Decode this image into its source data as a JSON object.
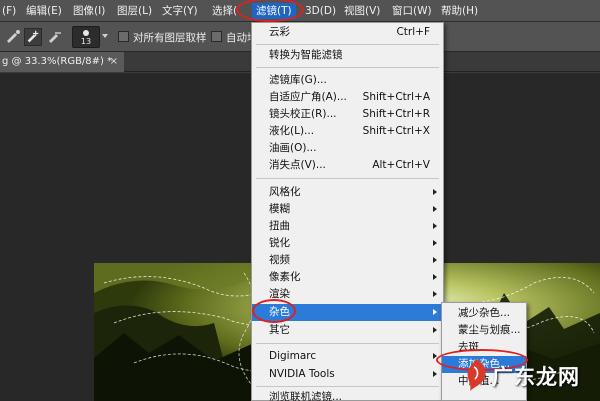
{
  "menubar": {
    "items": [
      "(F)",
      "编辑(E)",
      "图像(I)",
      "图层(L)",
      "文字(Y)",
      "选择(",
      "滤镜(T)",
      "3D(D)",
      "视图(V)",
      "窗口(W)",
      "帮助(H)"
    ],
    "active_index": 6
  },
  "options_bar": {
    "brush_size": "13",
    "sample_all_layers_label": "对所有图层取样",
    "auto_enhance_label": "自动增"
  },
  "document_tab": {
    "title": "g @ 33.3%(RGB/8#) *",
    "close_glyph": "×"
  },
  "filter_menu": {
    "items": [
      {
        "label": "云彩",
        "shortcut": "Ctrl+F"
      },
      {
        "label": "转换为智能滤镜"
      },
      {
        "label": "滤镜库(G)..."
      },
      {
        "label": "自适应广角(A)...",
        "shortcut": "Shift+Ctrl+A"
      },
      {
        "label": "镜头校正(R)...",
        "shortcut": "Shift+Ctrl+R"
      },
      {
        "label": "液化(L)...",
        "shortcut": "Shift+Ctrl+X"
      },
      {
        "label": "油画(O)..."
      },
      {
        "label": "消失点(V)...",
        "shortcut": "Alt+Ctrl+V"
      },
      {
        "label": "风格化",
        "submenu": true
      },
      {
        "label": "模糊",
        "submenu": true
      },
      {
        "label": "扭曲",
        "submenu": true
      },
      {
        "label": "锐化",
        "submenu": true
      },
      {
        "label": "视频",
        "submenu": true
      },
      {
        "label": "像素化",
        "submenu": true
      },
      {
        "label": "渲染",
        "submenu": true
      },
      {
        "label": "杂色",
        "submenu": true,
        "selected": true
      },
      {
        "label": "其它",
        "submenu": true
      },
      {
        "label": "Digimarc",
        "submenu": true
      },
      {
        "label": "NVIDIA Tools",
        "submenu": true
      },
      {
        "label": "浏览联机滤镜..."
      }
    ]
  },
  "noise_submenu": {
    "items": [
      {
        "label": "减少杂色..."
      },
      {
        "label": "蒙尘与划痕..."
      },
      {
        "label": "去斑"
      },
      {
        "label": "添加杂色...",
        "selected": true
      },
      {
        "label": "中间值..."
      }
    ]
  },
  "watermark": {
    "text": "广东龙网"
  },
  "colors": {
    "menu_highlight": "#2c7bd8",
    "annotation": "#e02020",
    "ui_panel": "#535353"
  }
}
